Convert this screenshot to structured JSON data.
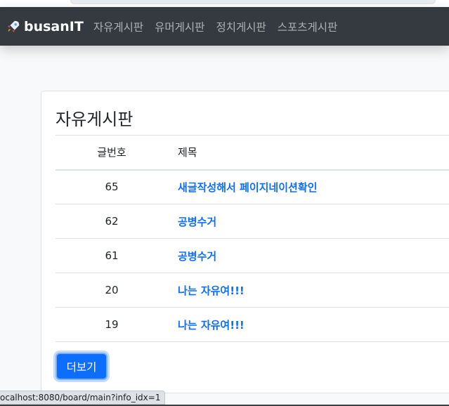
{
  "navbar": {
    "brand": "busanIT",
    "links": [
      "자유게시판",
      "유머게시판",
      "정치게시판",
      "스포츠게시판"
    ]
  },
  "board": {
    "title": "자유게시판",
    "columns": [
      "글번호",
      "제목"
    ],
    "rows": [
      {
        "idx": "65",
        "title": "새글작성해서 페이지네이션확인"
      },
      {
        "idx": "62",
        "title": "공병수거"
      },
      {
        "idx": "61",
        "title": "공병수거"
      },
      {
        "idx": "20",
        "title": "나는 자유여!!!"
      },
      {
        "idx": "19",
        "title": "나는 자유여!!!"
      }
    ],
    "more_label": "더보기"
  },
  "status_url": "ocalhost:8080/board/main?info_idx=1",
  "colors": {
    "navbar": "#343a40",
    "link": "#0d6efd",
    "button": "#0d6efd"
  }
}
